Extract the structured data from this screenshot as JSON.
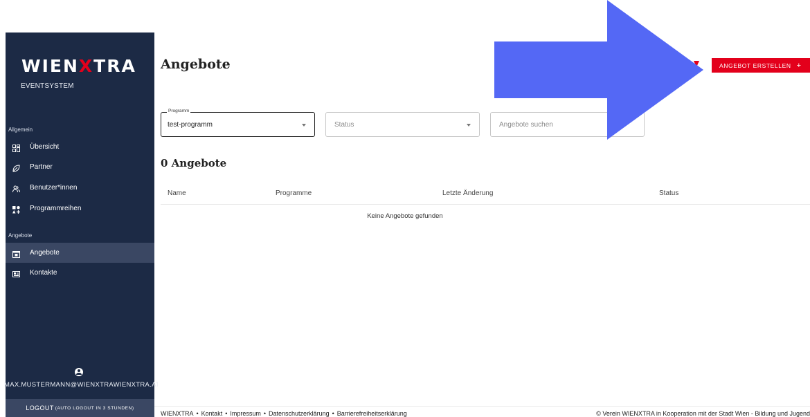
{
  "brand": {
    "name_part1": "WIEN",
    "name_x": "X",
    "name_part2": "TRA",
    "subtitle": "EVENTSYSTEM"
  },
  "sidebar": {
    "section_general": "Allgemein",
    "section_offers": "Angebote",
    "items": [
      {
        "label": "Übersicht",
        "icon": "dashboard-icon"
      },
      {
        "label": "Partner",
        "icon": "leaf-icon"
      },
      {
        "label": "Benutzer*innen",
        "icon": "users-icon"
      },
      {
        "label": "Programmreihen",
        "icon": "grid-add-icon"
      },
      {
        "label": "Angebote",
        "icon": "calendar-icon",
        "active": true
      },
      {
        "label": "Kontakte",
        "icon": "contact-card-icon"
      }
    ],
    "user_email": "MAX.MUSTERMANN@WIENXTRAWIENXTRA.AT",
    "logout_label": "LOGOUT",
    "logout_note": "(AUTO LOGOUT IN 3 STUNDEN)"
  },
  "header": {
    "title": "Angebote",
    "create_button": "ANGEBOT ERSTELLEN",
    "create_plus": "+"
  },
  "filters": {
    "program_legend": "Programm",
    "program_value": "test-programm",
    "status_placeholder": "Status",
    "search_placeholder": "Angebote suchen"
  },
  "results": {
    "count_title": "0 Angebote",
    "columns": [
      "Name",
      "Programme",
      "Letzte Änderung",
      "Status"
    ],
    "empty_message": "Keine Angebote gefunden"
  },
  "footer": {
    "links": [
      "WIENXTRA",
      "Kontakt",
      "Impressum",
      "Datenschutzerklärung",
      "Barrierefreiheitserklärung"
    ],
    "separator": "•",
    "copyright": "© Verein WIENXTRA in Kooperation mit der Stadt Wien - Bildung und Jugend"
  },
  "colors": {
    "sidebar": "#1c2a45",
    "accent_red": "#e3001b",
    "arrow_blue": "#5468f5"
  }
}
